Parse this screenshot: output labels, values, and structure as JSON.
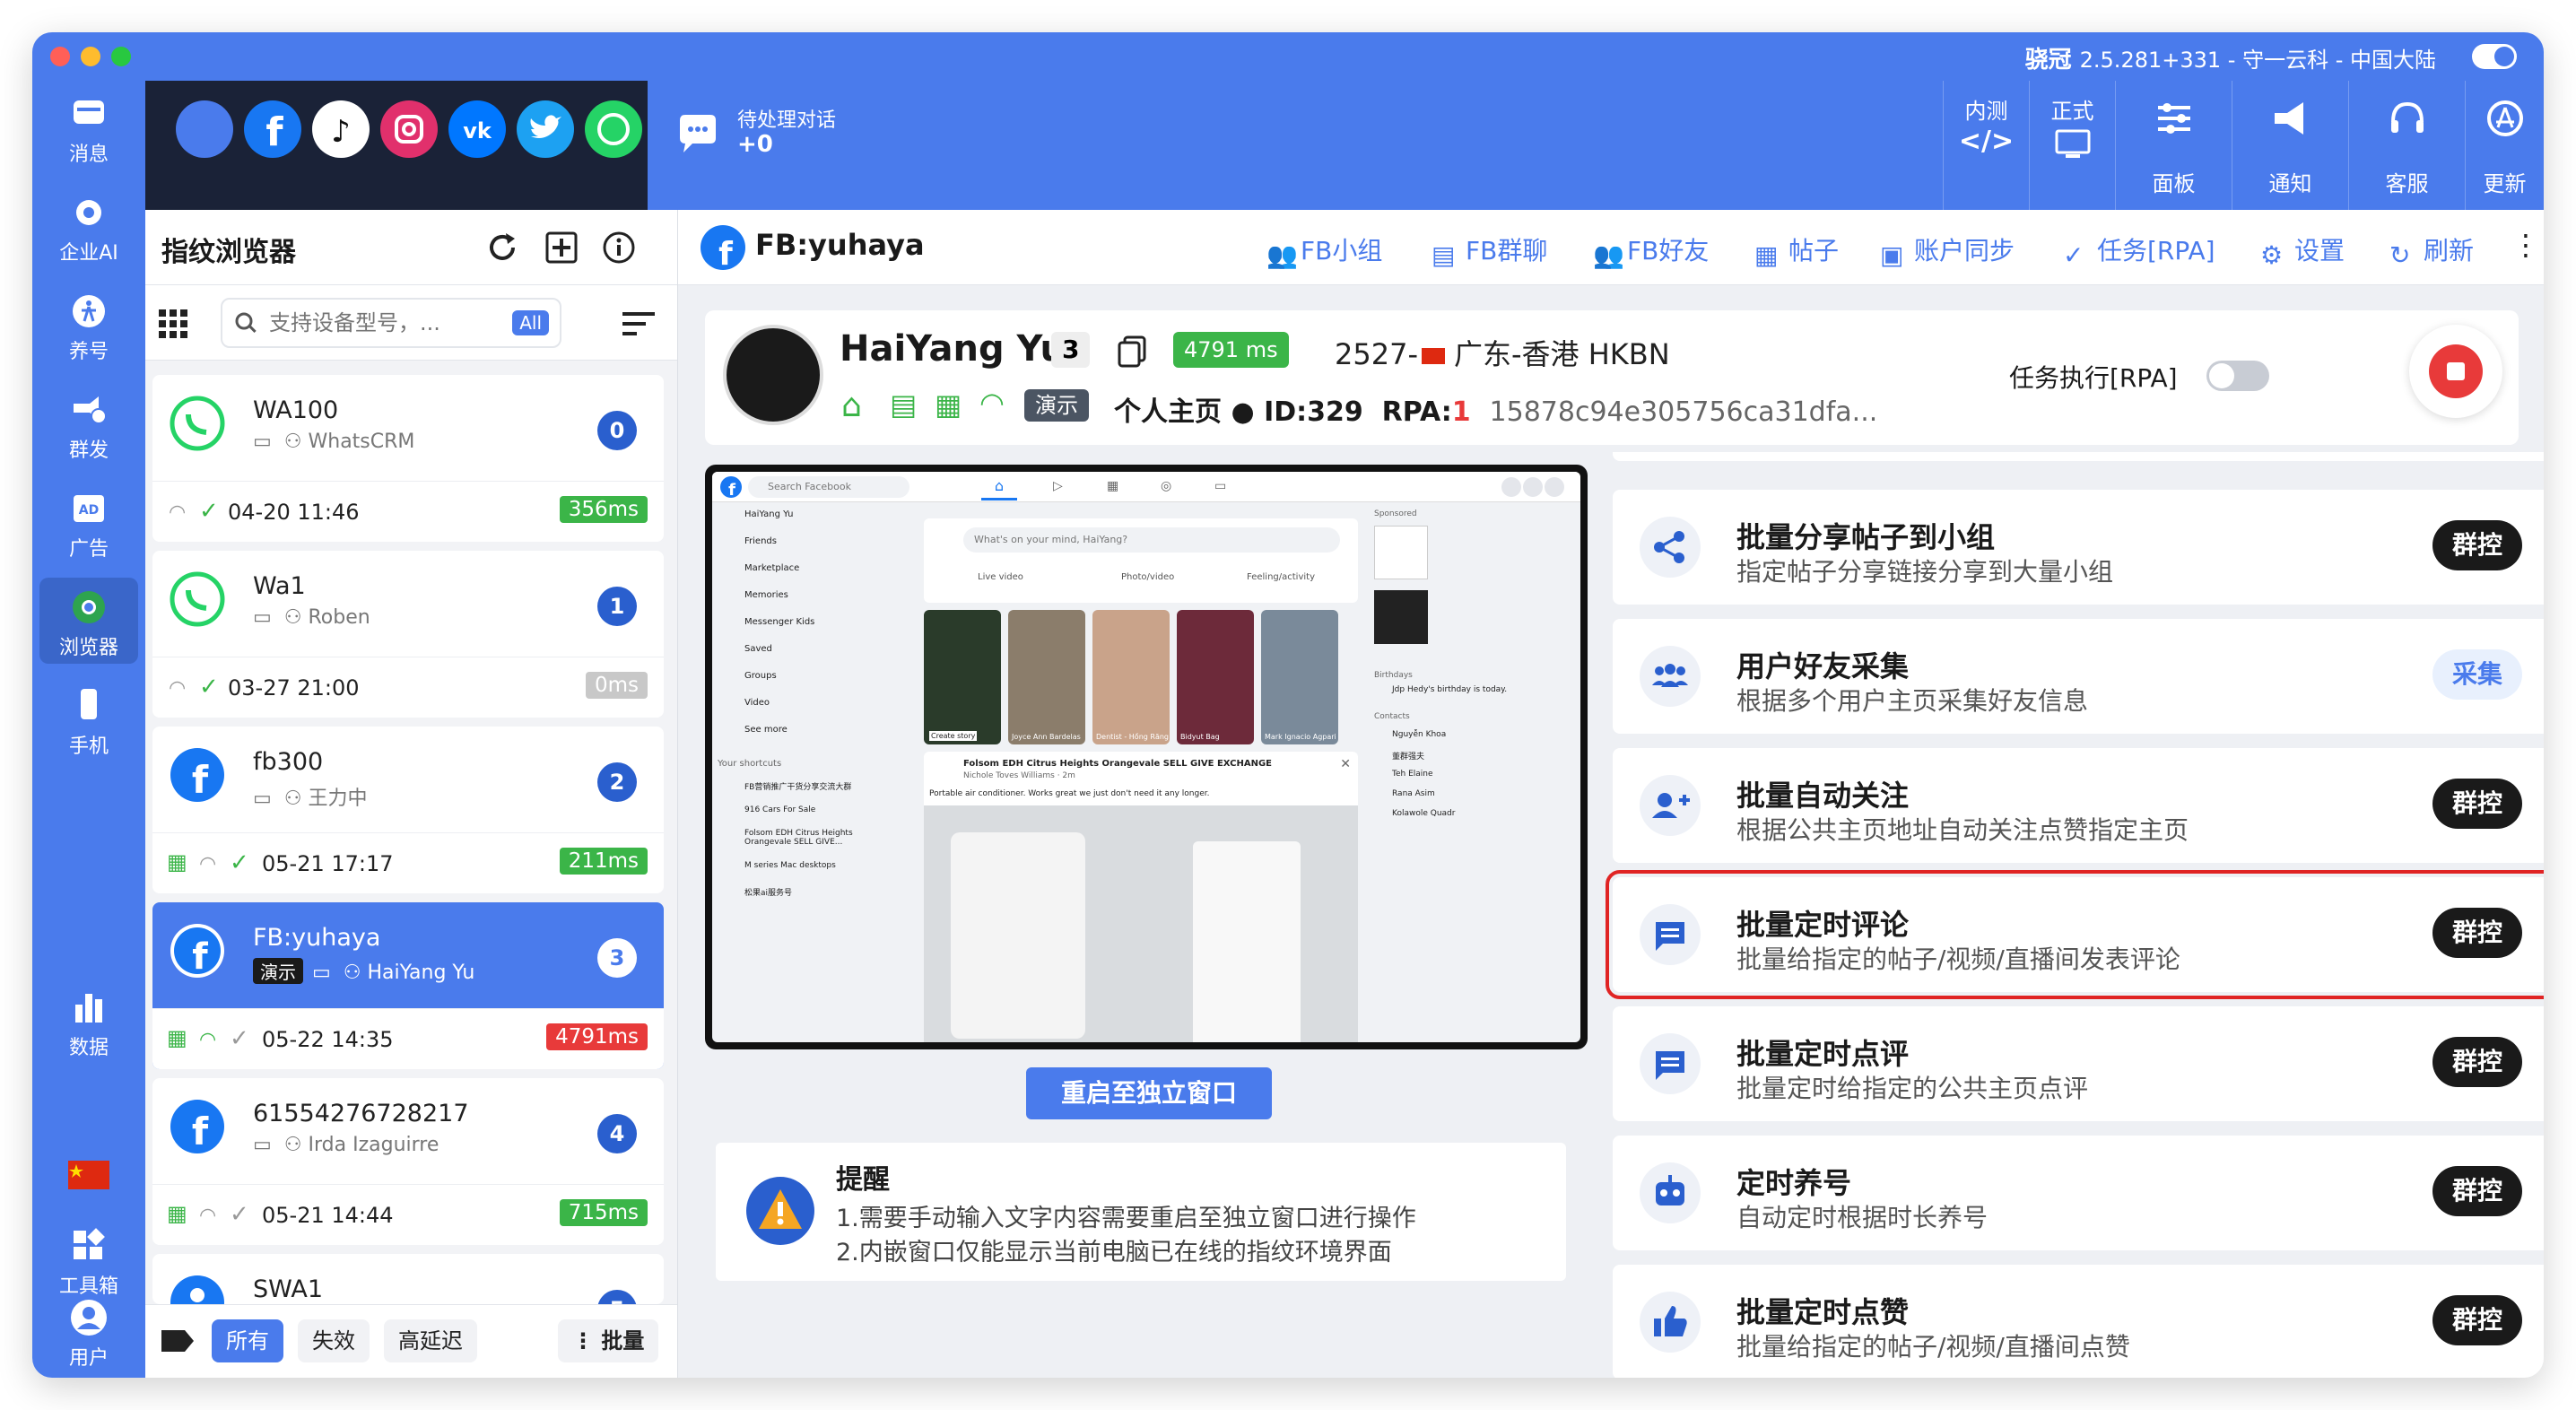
{
  "titlebar": {
    "app_name": "骁冠",
    "version_info": "2.5.281+331 - 守一云科 - 中国大陆"
  },
  "left_nav": {
    "items": [
      {
        "label": "消息",
        "icon": "message-icon"
      },
      {
        "label": "企业AI",
        "icon": "ai-icon"
      },
      {
        "label": "养号",
        "icon": "nurture-icon"
      },
      {
        "label": "群发",
        "icon": "broadcast-icon"
      },
      {
        "label": "广告",
        "icon": "ad-icon"
      },
      {
        "label": "浏览器",
        "icon": "browser-icon"
      },
      {
        "label": "手机",
        "icon": "phone-icon"
      },
      {
        "label": "数据",
        "icon": "chart-icon"
      },
      {
        "label": "工具箱",
        "icon": "toolbox-icon"
      },
      {
        "label": "用户",
        "icon": "user-icon"
      }
    ]
  },
  "topbar": {
    "pending_label": "待处理对话",
    "pending_count": "+0",
    "test_label": "内测",
    "prod_label": "正式",
    "buttons": [
      {
        "label": "面板"
      },
      {
        "label": "通知"
      },
      {
        "label": "客服"
      },
      {
        "label": "更新"
      }
    ]
  },
  "browser_panel": {
    "title": "指纹浏览器",
    "search_placeholder": "支持设备型号，...",
    "all_badge": "All",
    "devices": [
      {
        "name": "WA100",
        "sub": "WhatsCRM",
        "num": "0",
        "time": "04-20 11:46",
        "ping": "356ms"
      },
      {
        "name": "Wa1",
        "sub": "Roben",
        "num": "1",
        "time": "03-27 21:00",
        "ping": "0ms"
      },
      {
        "name": "fb300",
        "sub": "王力中",
        "num": "2",
        "time": "05-21 17:17",
        "ping": "211ms"
      },
      {
        "name": "FB:yuhaya",
        "tag": "演示",
        "sub": "HaiYang Yu",
        "num": "3",
        "time": "05-22 14:35",
        "ping": "4791ms"
      },
      {
        "name": "61554276728217",
        "sub": "Irda Izaguirre",
        "num": "4",
        "time": "05-21 14:44",
        "ping": "715ms"
      },
      {
        "name": "SWA1",
        "num": "5"
      }
    ],
    "footer": {
      "all": "所有",
      "invalid": "失效",
      "high_latency": "高延迟",
      "batch": "批量"
    }
  },
  "main": {
    "header_title": "FB:yuhaya",
    "links": [
      "FB小组",
      "FB群聊",
      "FB好友",
      "帖子",
      "账户同步",
      "任务[RPA]",
      "设置",
      "刷新"
    ],
    "profile": {
      "name": "HaiYang Yu",
      "num": "3",
      "latency": "4791 ms",
      "region": "2527-",
      "isp": "广东-香港 HKBN",
      "demo_tag": "演示",
      "home_label": "个人主页",
      "id_label": "ID:329",
      "rpa_label": "RPA:",
      "rpa_value": "1",
      "hash": "15878c94e305756ca31dfa...",
      "task_exec_label": "任务执行[RPA]"
    },
    "embedded": {
      "search_placeholder": "Search Facebook",
      "left_items": [
        "HaiYang Yu",
        "Friends",
        "Marketplace",
        "Memories",
        "Messenger Kids",
        "Saved",
        "Groups",
        "Video",
        "See more"
      ],
      "shortcuts_title": "Your shortcuts",
      "shortcuts": [
        "FB营销推广干货分享交流大群",
        "916 Cars For Sale",
        "Folsom EDH Citrus Heights Orangevale SELL GIVE...",
        "M series Mac desktops",
        "松果ai服务号"
      ],
      "composer_placeholder": "What's on your mind, HaiYang?",
      "composer_actions": [
        "Live video",
        "Photo/video",
        "Feeling/activity"
      ],
      "stories": [
        "Create story",
        "Joyce Ann Bardelas",
        "Dentist - Hồng Răng",
        "Bidyut Bag",
        "Mark Ignacio Agpari"
      ],
      "post_group": "Folsom EDH Citrus Heights Orangevale SELL GIVE EXCHANGE",
      "post_author": "Nichole Toves Williams · 2m",
      "post_text": "Portable air conditioner. Works great we just don't need it any longer.",
      "sponsored": "Sponsored",
      "birthdays": "Birthdays",
      "birthday_text": "Jdp Hedy's birthday is today.",
      "contacts": "Contacts",
      "contact_list": [
        "Nguyễn Khoa",
        "董群强夫",
        "Teh Elaine",
        "Rana Asim",
        "Kolawole Quadr"
      ]
    },
    "restart_button": "重启至独立窗口",
    "notice": {
      "title": "提醒",
      "line1": "1.需要手动输入文字内容需要重启至独立窗口进行操作",
      "line2": "2.内嵌窗口仅能显示当前电脑已在线的指纹环境界面"
    },
    "tasks": [
      {
        "title": "批量分享帖子到小组",
        "desc": "指定帖子分享链接分享到大量小组",
        "action": "群控",
        "icon": "share-icon"
      },
      {
        "title": "用户好友采集",
        "desc": "根据多个用户主页采集好友信息",
        "action": "采集",
        "icon": "users-icon"
      },
      {
        "title": "批量自动关注",
        "desc": "根据公共主页地址自动关注点赞指定主页",
        "action": "群控",
        "icon": "add-user-icon"
      },
      {
        "title": "批量定时评论",
        "desc": "批量给指定的帖子/视频/直播间发表评论",
        "action": "群控",
        "icon": "comment-icon"
      },
      {
        "title": "批量定时点评",
        "desc": "批量定时给指定的公共主页点评",
        "action": "群控",
        "icon": "review-icon"
      },
      {
        "title": "定时养号",
        "desc": "自动定时根据时长养号",
        "action": "群控",
        "icon": "robot-icon"
      },
      {
        "title": "批量定时点赞",
        "desc": "批量给指定的帖子/视频/直播间点赞",
        "action": "群控",
        "icon": "thumbs-up-icon"
      }
    ]
  },
  "colors": {
    "accent": "#4a7bec",
    "dark": "#1a2237",
    "green": "#3bb548",
    "red": "#e83a3a",
    "highlight": "#e02424"
  }
}
